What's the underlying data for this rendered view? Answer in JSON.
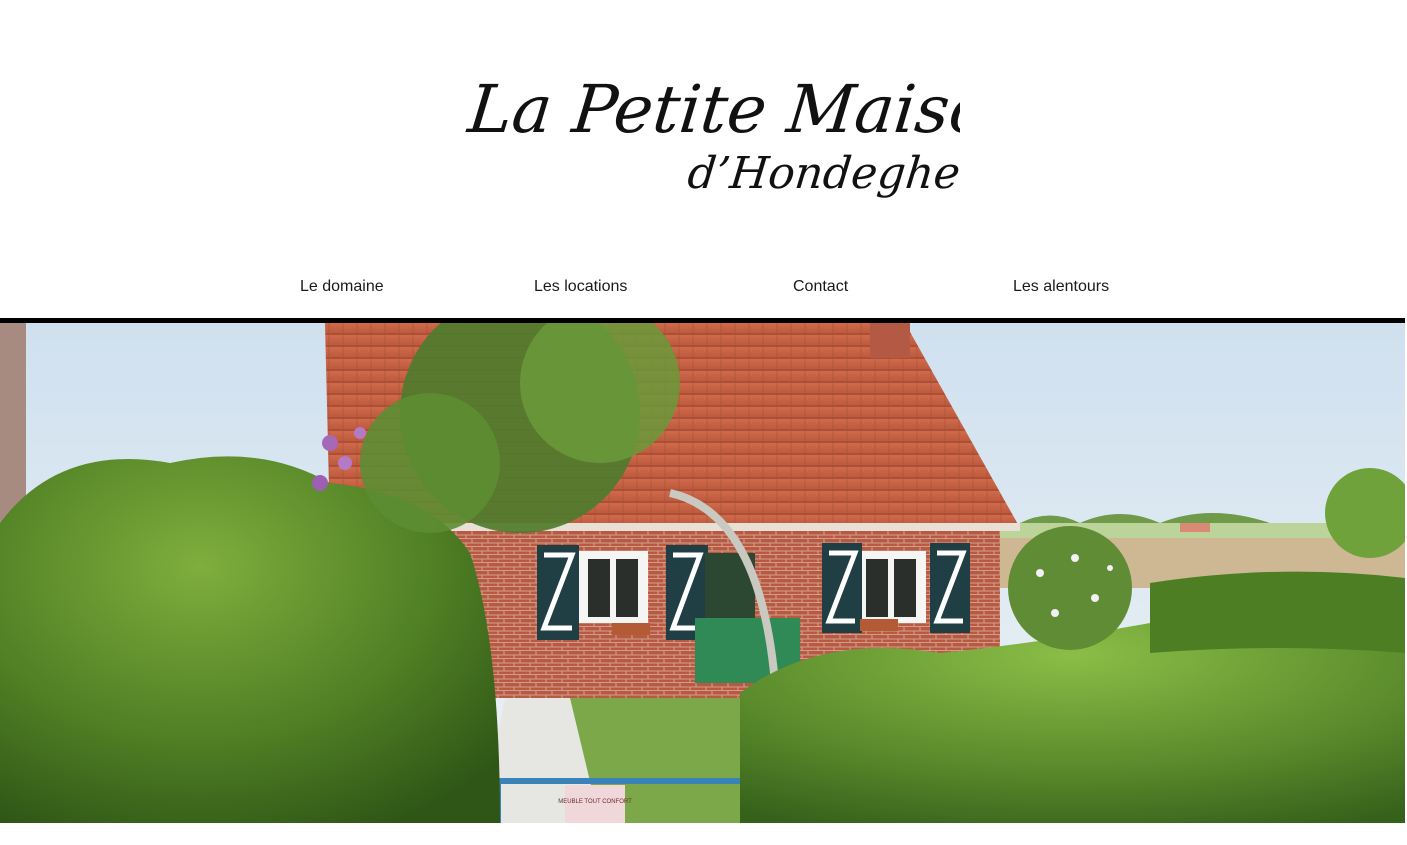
{
  "header": {
    "logo": {
      "line1": "La Petite Maison",
      "line2": "d’Hondeghem"
    }
  },
  "nav": {
    "items": [
      {
        "label": "Le domaine"
      },
      {
        "label": "Les locations"
      },
      {
        "label": "Contact"
      },
      {
        "label": "Les alentours"
      }
    ]
  },
  "hero": {
    "icon": "house-photo",
    "sign_text": "MEUBLE TOUT CONFORT"
  },
  "colors": {
    "text": "#1a1a1a",
    "divider": "#000000",
    "roof": "#c8664a",
    "shutters": "#1f3f44",
    "hedge": "#4a7a2a",
    "sky": "#dbe8f2"
  }
}
